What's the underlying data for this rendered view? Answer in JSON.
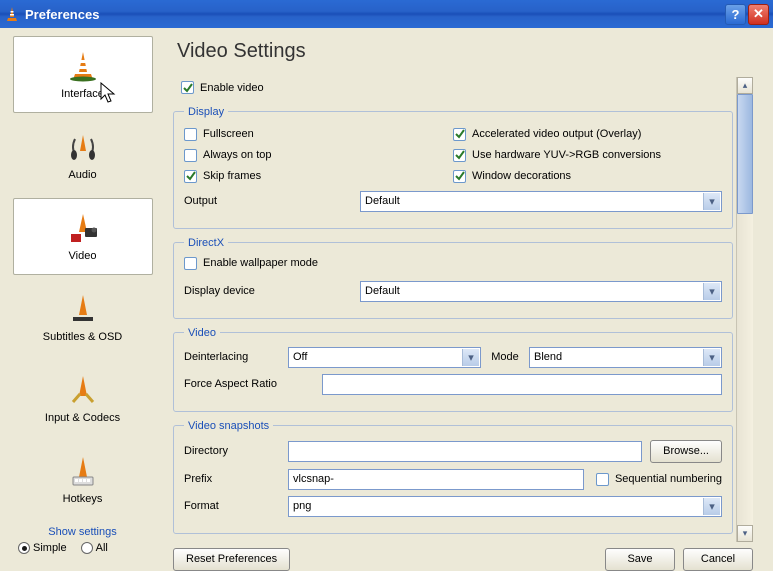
{
  "window": {
    "title": "Preferences"
  },
  "sidebar": {
    "items": [
      {
        "label": "Interface"
      },
      {
        "label": "Audio"
      },
      {
        "label": "Video"
      },
      {
        "label": "Subtitles & OSD"
      },
      {
        "label": "Input & Codecs"
      },
      {
        "label": "Hotkeys"
      }
    ],
    "show_settings_label": "Show settings",
    "simple_label": "Simple",
    "all_label": "All",
    "mode": "simple"
  },
  "page": {
    "title": "Video Settings",
    "enable_video_label": "Enable video",
    "enable_video": true
  },
  "display": {
    "legend": "Display",
    "fullscreen_label": "Fullscreen",
    "fullscreen": false,
    "always_on_top_label": "Always on top",
    "always_on_top": false,
    "skip_frames_label": "Skip frames",
    "skip_frames": true,
    "accel_label": "Accelerated video output (Overlay)",
    "accel": true,
    "yuv_label": "Use hardware YUV->RGB conversions",
    "yuv": true,
    "windeco_label": "Window decorations",
    "windeco": true,
    "output_label": "Output",
    "output_value": "Default"
  },
  "directx": {
    "legend": "DirectX",
    "wallpaper_label": "Enable wallpaper mode",
    "wallpaper": false,
    "display_device_label": "Display device",
    "display_device_value": "Default"
  },
  "video": {
    "legend": "Video",
    "deint_label": "Deinterlacing",
    "deint_value": "Off",
    "mode_label": "Mode",
    "mode_value": "Blend",
    "force_ar_label": "Force Aspect Ratio",
    "force_ar_value": ""
  },
  "snapshots": {
    "legend": "Video snapshots",
    "directory_label": "Directory",
    "directory_value": "",
    "browse_label": "Browse...",
    "prefix_label": "Prefix",
    "prefix_value": "vlcsnap-",
    "seq_label": "Sequential numbering",
    "seq": false,
    "format_label": "Format",
    "format_value": "png"
  },
  "footer": {
    "reset_label": "Reset Preferences",
    "save_label": "Save",
    "cancel_label": "Cancel"
  }
}
